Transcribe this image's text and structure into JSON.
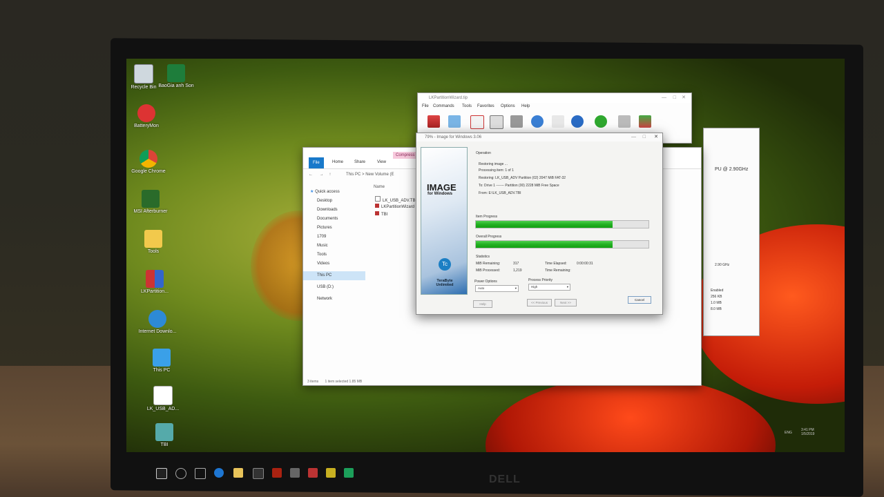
{
  "desktop_icons": [
    {
      "label": "Recycle Bin",
      "icon": "recycle-bin-icon"
    },
    {
      "label": "BaoGia anh Son",
      "icon": "excel-icon"
    },
    {
      "label": "BatteryMon",
      "icon": "battery-icon"
    },
    {
      "label": "Google Chrome",
      "icon": "chrome-icon"
    },
    {
      "label": "MSI Afterburner",
      "icon": "afterburner-icon"
    },
    {
      "label": "Tools",
      "icon": "folder-icon"
    },
    {
      "label": "LKPartition...",
      "icon": "app-icon"
    },
    {
      "label": "Internet Downlo...",
      "icon": "idm-icon"
    },
    {
      "label": "This PC",
      "icon": "pc-icon"
    },
    {
      "label": "LK_USB_AD...",
      "icon": "file-icon"
    },
    {
      "label": "TBI",
      "icon": "tbi-icon"
    }
  ],
  "lkwin": {
    "title": "LKPartitionWizard.tip",
    "menu": [
      "File",
      "Commands",
      "Tools",
      "Favorites",
      "Options",
      "Help"
    ],
    "tools": [
      "Add",
      "Extract To",
      "Test",
      "View",
      "Delete",
      "Find",
      "Wizard",
      "Info",
      "VirusScan",
      "Comment",
      "SFX"
    ]
  },
  "explorer": {
    "tabs": [
      "File",
      "Home",
      "Share",
      "View"
    ],
    "contextual_tab": "Compress",
    "path": [
      "This PC",
      "New Volume (E"
    ],
    "column_header": "Name",
    "quick_access": "Quick access",
    "nav_items": [
      "Desktop",
      "Downloads",
      "Documents",
      "Pictures",
      "1709",
      "Music",
      "Tools",
      "Videos"
    ],
    "this_pc": "This PC",
    "usb": "USB (D:)",
    "network": "Network",
    "files": [
      "LK_USB_ADV.TBI",
      "LKPartitionWizard",
      "TBI"
    ],
    "status_items": "3 items",
    "status_selected": "1 item selected  1.85 MB"
  },
  "ifw": {
    "title": "79% - Image for Windows 3.06",
    "brand_main": "IMAGE",
    "brand_sub": "for Windows",
    "brand_logo": "Tc",
    "brand_company": "TeraByte Unlimited",
    "operation_label": "Operation",
    "status": "Restoring image ...",
    "processing": "Processing item: 1 of 1",
    "restoring": "Restoring: LK_USB_ADV Partition (02) 2047 MiB FAT-32",
    "to": "To: Drive 1 ------- Partition (00) 2228 MiB Free Space",
    "from": "From: E:\\LK_USB_ADV.TBI",
    "item_progress_label": "Item Progress",
    "item_progress": 0.79,
    "overall_progress_label": "Overall Progress",
    "overall_progress": 0.79,
    "statistics_label": "Statistics",
    "mib_remaining_label": "MiB Remaining:",
    "mib_remaining": "317",
    "mib_processed_label": "MiB Processed:",
    "mib_processed": "1,219",
    "time_elapsed_label": "Time Elapsed:",
    "time_elapsed": "0:00:00:31",
    "time_remaining_label": "Time Remaining:",
    "time_remaining": "",
    "power_options_label": "Power Options",
    "power_option": "Auto",
    "process_priority_label": "Process Priority",
    "process_priority": "High",
    "help_btn": "Help",
    "prev_btn": "<< Previous",
    "next_btn": "Next >>",
    "cancel_btn": "Cancel"
  },
  "rightwin": {
    "path": "New Volume (E:)",
    "cpu_title": "PU @ 2.90GHz",
    "speed": "2.90 GHz",
    "enabled": "Enabled",
    "l1": "256 KB",
    "l2": "1.0 MB",
    "l3": "8.0 MB"
  },
  "taskbar": {
    "lang": "ENG",
    "time": "3:41 PM",
    "date": "1/5/2019"
  },
  "brand": "DELL"
}
